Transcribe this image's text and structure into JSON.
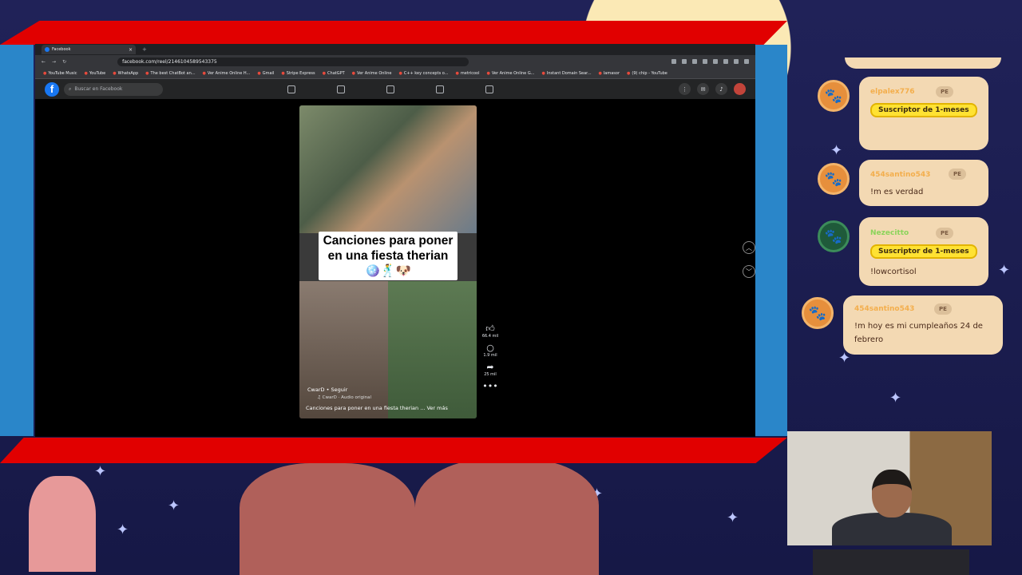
{
  "browser": {
    "tab_title": "Facebook",
    "new_tab": "+",
    "url": "facebook.com/reel/2146104589543375",
    "bookmarks": [
      "YouTube Music",
      "YouTube",
      "WhatsApp",
      "The best ChatBot an...",
      "Ver Anime Online H...",
      "Gmail",
      "Stripe Express",
      "ChatGPT",
      "Ver Anime Online",
      "C++ key concepts o...",
      "metricool",
      "Ver Anime Online G...",
      "Instant Domain Sear...",
      "lamasor",
      "(9) chip - YouTube"
    ]
  },
  "facebook": {
    "logo": "f",
    "search_placeholder": "Buscar en Facebook",
    "reel": {
      "caption": "Canciones para poner en una fiesta therian 🪩🕺🐶",
      "author": "CwarD • Seguir",
      "audio": "♫ CwarD · Audio original",
      "description": "Canciones para poner en una fiesta therian ... Ver más"
    },
    "actions": {
      "likes": "66.4 mil",
      "comments": "1.9 mil",
      "shares": "25 mil",
      "more": "•••"
    }
  },
  "chat": {
    "messages": [
      {
        "user": "elpalex776",
        "badge": "PE",
        "sub_badge": "Suscriptor de 1-meses",
        "text": ""
      },
      {
        "user": "454santino543",
        "badge": "PE",
        "sub_badge": "",
        "text": "!m es verdad"
      },
      {
        "user": "Nezecitto",
        "badge": "PE",
        "sub_badge": "Suscriptor de 1-meses",
        "text": "!lowcortisol"
      },
      {
        "user": "454santino543",
        "badge": "PE",
        "sub_badge": "",
        "text": "!m hoy es mi cumpleaños 24 de febrero"
      }
    ]
  },
  "colors": {
    "frame_red": "#e10000",
    "facebook_blue": "#1877f2",
    "chat_bubble": "#f3d9b3",
    "sub_badge": "#ffe233"
  }
}
